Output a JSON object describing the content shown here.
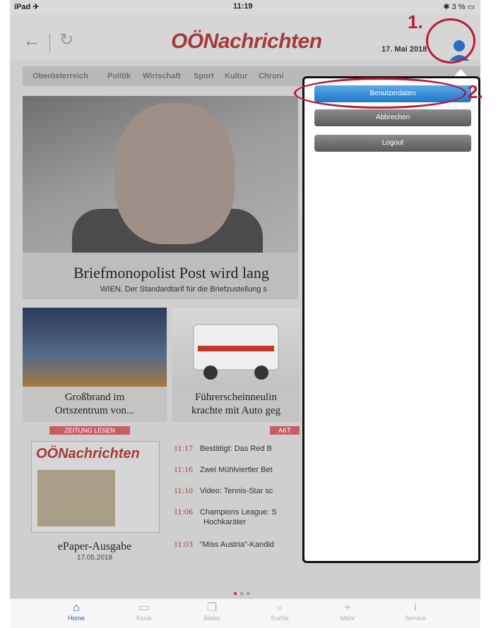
{
  "status": {
    "carrier": "iPad ✈",
    "time": "11:19",
    "battery": "✱ 3 % ▭"
  },
  "header": {
    "back_icon": "←",
    "reload_icon": "↻",
    "logo": "OÖNachrichten",
    "date": "17. Mai 2018"
  },
  "categories": [
    "Oberösterreich",
    "Politik",
    "Wirtschaft",
    "Sport",
    "Kultur",
    "Chroni"
  ],
  "hero": {
    "title": "Briefmonopolist Post wird lang",
    "subtitle": "WIEN. Der Standardtarif für die Briefzustellung s"
  },
  "cards": [
    {
      "title_line1": "Großbrand im",
      "title_line2": "Ortszentrum von..."
    },
    {
      "title_line1": "Führerscheinneulin",
      "title_line2": "krachte mit Auto geg"
    }
  ],
  "tags": {
    "zeitung": "ZEITUNG LESEN",
    "aktuell": "AKT"
  },
  "epaper": {
    "logo": "OÖNachrichten",
    "title": "ePaper-Ausgabe",
    "date": "17.05.2018"
  },
  "news": [
    {
      "time": "11:17",
      "text": "Bestätigt: Das Red B"
    },
    {
      "time": "11:16",
      "text": "Zwei Mühlviertler Bet"
    },
    {
      "time": "11:10",
      "text": "Video: Tennis-Star sc"
    },
    {
      "time": "11:06",
      "text": "Champions League: S",
      "text2": "Hochkaräter"
    },
    {
      "time": "11:03",
      "text": "\"Miss Austria\"-Kandid"
    }
  ],
  "popover": {
    "buttons": [
      "Benutzerdaten",
      "Abbrechen",
      "Logout"
    ]
  },
  "annotations": {
    "step1": "1.",
    "step2": "2."
  },
  "tabbar": [
    {
      "label": "Home",
      "icon": "home-icon"
    },
    {
      "label": "Kiosk",
      "icon": "kiosk-icon"
    },
    {
      "label": "Bilder",
      "icon": "gallery-icon"
    },
    {
      "label": "Suche",
      "icon": "search-icon"
    },
    {
      "label": "Mehr",
      "icon": "plus-icon"
    },
    {
      "label": "Service",
      "icon": "info-icon"
    }
  ],
  "colors": {
    "accent": "#2b5fa8",
    "annotation": "#b71c3c",
    "brand": "#a43a3a"
  }
}
